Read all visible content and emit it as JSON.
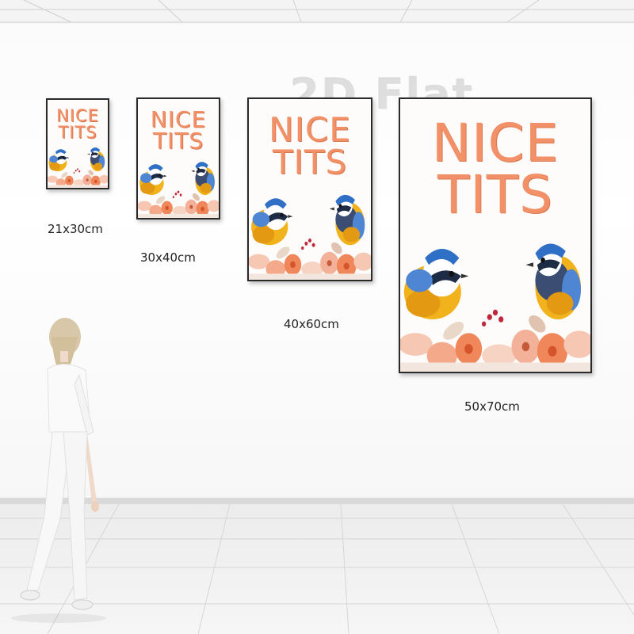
{
  "watermark": "2D Flat",
  "posters": [
    {
      "title_line1": "NICE",
      "title_line2": "TITS",
      "size_label": "21x30cm"
    },
    {
      "title_line1": "NICE",
      "title_line2": "TITS",
      "size_label": "30x40cm"
    },
    {
      "title_line1": "NICE",
      "title_line2": "TITS",
      "size_label": "40x60cm"
    },
    {
      "title_line1": "NICE",
      "title_line2": "TITS",
      "size_label": "50x70cm"
    }
  ],
  "colors": {
    "title": "#f29068",
    "frame": "#2a2a2a",
    "bird_blue": "#2f6fc6",
    "bird_yellow": "#f2b21c",
    "flower": "#f0875a"
  },
  "icons": [
    "blue-tit-bird-illustration",
    "flower-illustration",
    "woman-figure"
  ]
}
